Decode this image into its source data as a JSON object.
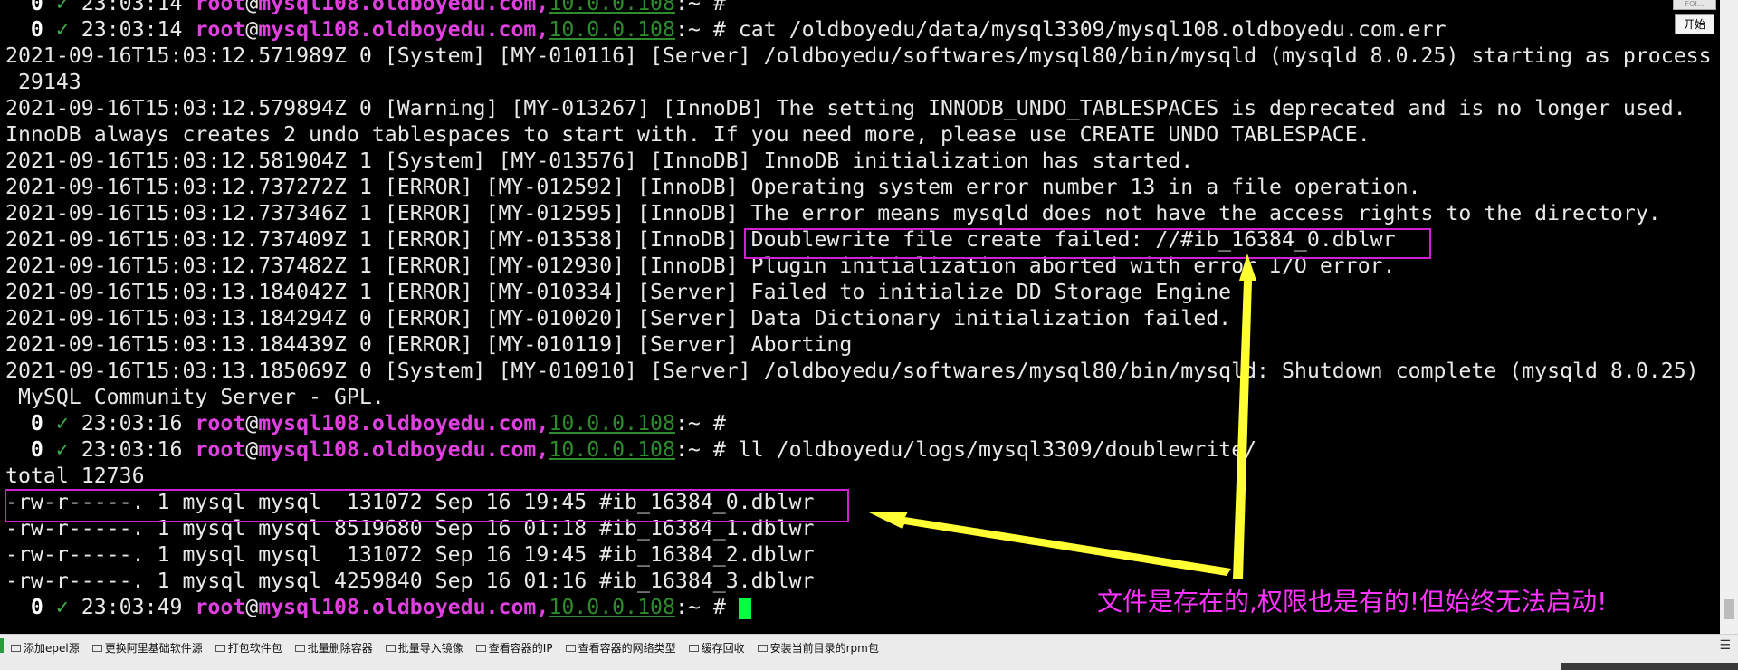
{
  "prompt": {
    "exit_code": "0",
    "check": "✓",
    "user": "root",
    "at": "@",
    "host": "mysql108.oldboyedu.com,",
    "ip": "10.0.0.108",
    "path": ":~ #"
  },
  "lines": [
    {
      "type": "prompt",
      "time": "23:03:14",
      "cmd": ""
    },
    {
      "type": "prompt",
      "time": "23:03:14",
      "cmd": "cat /oldboyedu/data/mysql3309/mysql108.oldboyedu.com.err"
    },
    {
      "type": "text",
      "text": "2021-09-16T15:03:12.571989Z 0 [System] [MY-010116] [Server] /oldboyedu/softwares/mysql80/bin/mysqld (mysqld 8.0.25) starting as process"
    },
    {
      "type": "text",
      "text": " 29143"
    },
    {
      "type": "text",
      "text": "2021-09-16T15:03:12.579894Z 0 [Warning] [MY-013267] [InnoDB] The setting INNODB_UNDO_TABLESPACES is deprecated and is no longer used."
    },
    {
      "type": "text",
      "text": "InnoDB always creates 2 undo tablespaces to start with. If you need more, please use CREATE UNDO TABLESPACE."
    },
    {
      "type": "text",
      "text": "2021-09-16T15:03:12.581904Z 1 [System] [MY-013576] [InnoDB] InnoDB initialization has started."
    },
    {
      "type": "text",
      "text": "2021-09-16T15:03:12.737272Z 1 [ERROR] [MY-012592] [InnoDB] Operating system error number 13 in a file operation."
    },
    {
      "type": "text",
      "text": "2021-09-16T15:03:12.737346Z 1 [ERROR] [MY-012595] [InnoDB] The error means mysqld does not have the access rights to the directory."
    },
    {
      "type": "text",
      "text": "2021-09-16T15:03:12.737409Z 1 [ERROR] [MY-013538] [InnoDB] Doublewrite file create failed: //#ib_16384_0.dblwr"
    },
    {
      "type": "text",
      "text": "2021-09-16T15:03:12.737482Z 1 [ERROR] [MY-012930] [InnoDB] Plugin initialization aborted with error I/O error."
    },
    {
      "type": "text",
      "text": "2021-09-16T15:03:13.184042Z 1 [ERROR] [MY-010334] [Server] Failed to initialize DD Storage Engine"
    },
    {
      "type": "text",
      "text": "2021-09-16T15:03:13.184294Z 0 [ERROR] [MY-010020] [Server] Data Dictionary initialization failed."
    },
    {
      "type": "text",
      "text": "2021-09-16T15:03:13.184439Z 0 [ERROR] [MY-010119] [Server] Aborting"
    },
    {
      "type": "text",
      "text": "2021-09-16T15:03:13.185069Z 0 [System] [MY-010910] [Server] /oldboyedu/softwares/mysql80/bin/mysqld: Shutdown complete (mysqld 8.0.25)"
    },
    {
      "type": "text",
      "text": " MySQL Community Server - GPL."
    },
    {
      "type": "prompt",
      "time": "23:03:16",
      "cmd": ""
    },
    {
      "type": "prompt",
      "time": "23:03:16",
      "cmd": "ll /oldboyedu/logs/mysql3309/doublewrite/"
    },
    {
      "type": "text",
      "text": "total 12736"
    },
    {
      "type": "text",
      "text": "-rw-r-----. 1 mysql mysql  131072 Sep 16 19:45 #ib_16384_0.dblwr"
    },
    {
      "type": "text",
      "text": "-rw-r-----. 1 mysql mysql 8519680 Sep 16 01:18 #ib_16384_1.dblwr"
    },
    {
      "type": "text",
      "text": "-rw-r-----. 1 mysql mysql  131072 Sep 16 19:45 #ib_16384_2.dblwr"
    },
    {
      "type": "text",
      "text": "-rw-r-----. 1 mysql mysql 4259840 Sep 16 01:16 #ib_16384_3.dblwr"
    },
    {
      "type": "prompt",
      "time": "23:03:49",
      "cmd": "",
      "cursor": true
    }
  ],
  "annotation": {
    "note": "文件是存在的,权限也是有的!但始终无法启动!",
    "arrow_color": "#ffff33",
    "box_color": "#d020d0"
  },
  "side": {
    "start_button": "开始",
    "top_chip": "FOI..."
  },
  "bottom_bar": {
    "items": [
      "添加epel源",
      "更换阿里基础软件源",
      "打包软件包",
      "批量删除容器",
      "批量导入镜像",
      "查看容器的IP",
      "查看容器的网络类型",
      "缓存回收",
      "安装当前目录的rpm包"
    ]
  },
  "colors": {
    "background": "#000000",
    "text": "#e8e8e8",
    "prompt_user": "#e040e0",
    "prompt_ip": "#2e8b2e",
    "cursor": "#00ff40"
  }
}
